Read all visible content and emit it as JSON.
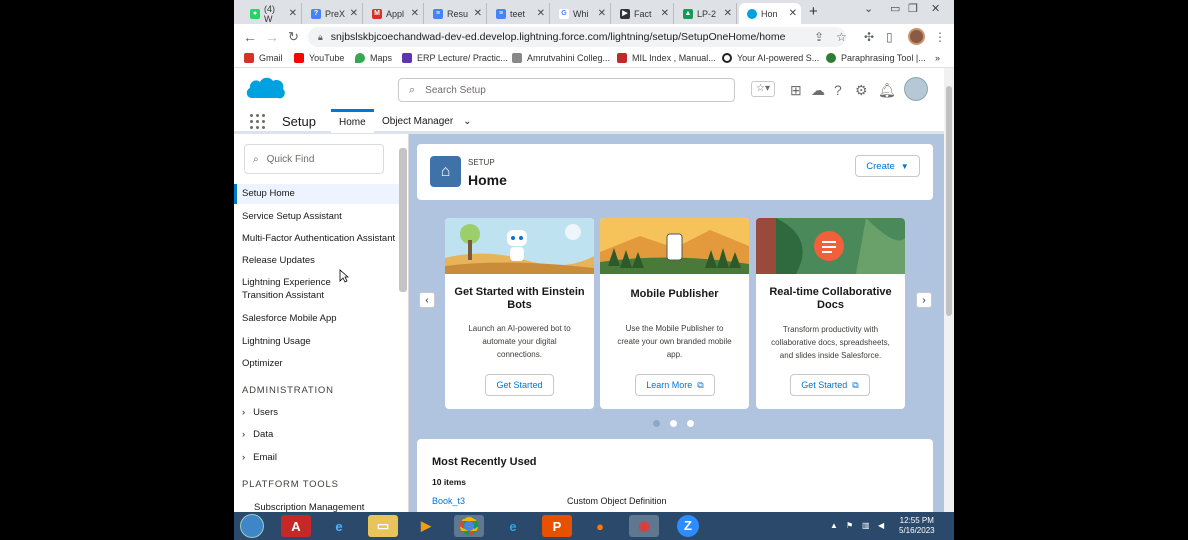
{
  "browser": {
    "tabs": [
      {
        "label": "(4) W",
        "color": "#25d366",
        "icon": "whatsapp-icon"
      },
      {
        "label": "PreX",
        "color": "#4285f4",
        "icon": "question-icon"
      },
      {
        "label": "Appl",
        "color": "#d93025",
        "icon": "gmail-icon"
      },
      {
        "label": "Resu",
        "color": "#4285f4",
        "icon": "docs-icon"
      },
      {
        "label": "teet",
        "color": "#4285f4",
        "icon": "docs-icon"
      },
      {
        "label": "Whi",
        "color": "#4285f4",
        "icon": "google-icon"
      },
      {
        "label": "Fact",
        "color": "#333333",
        "icon": "bookmark-icon"
      },
      {
        "label": "LP-2",
        "color": "#0f9d58",
        "icon": "drive-icon"
      },
      {
        "label": "Hon",
        "color": "#00a1e0",
        "icon": "salesforce-icon"
      }
    ],
    "url": "snjbslskbjcoechandwad-dev-ed.develop.lightning.force.com/lightning/setup/SetupOneHome/home",
    "bookmarks": [
      {
        "label": "Gmail",
        "color": "#d93025"
      },
      {
        "label": "YouTube",
        "color": "#ff0000"
      },
      {
        "label": "Maps",
        "color": "#34a853"
      },
      {
        "label": "ERP Lecture/ Practic...",
        "color": "#5e35b1"
      },
      {
        "label": "Amrutvahini Colleg...",
        "color": "#888888"
      },
      {
        "label": "MIL Index , Manual...",
        "color": "#c62828"
      },
      {
        "label": "Your AI-powered S...",
        "color": "#222222"
      },
      {
        "label": "Paraphrasing Tool |...",
        "color": "#2e7d32"
      }
    ]
  },
  "header": {
    "search_placeholder": "Search Setup"
  },
  "nav": {
    "app_name": "Setup",
    "tabs": [
      "Home",
      "Object Manager"
    ]
  },
  "sidebar": {
    "quick_find_placeholder": "Quick Find",
    "items": [
      "Setup Home",
      "Service Setup Assistant",
      "Multi-Factor Authentication Assistant",
      "Release Updates",
      "Lightning Experience Transition Assistant",
      "Salesforce Mobile App",
      "Lightning Usage",
      "Optimizer"
    ],
    "section_admin": "ADMINISTRATION",
    "admin_items": [
      "Users",
      "Data",
      "Email"
    ],
    "section_platform": "PLATFORM TOOLS",
    "platform_items": [
      "Subscription Management"
    ]
  },
  "home": {
    "setup_label": "SETUP",
    "title": "Home",
    "create_label": "Create",
    "cards": [
      {
        "title": "Get Started with Einstein Bots",
        "desc": "Launch an AI-powered bot to automate your digital connections.",
        "button": "Get Started",
        "external": false
      },
      {
        "title": "Mobile Publisher",
        "desc": "Use the Mobile Publisher to create your own branded mobile app.",
        "button": "Learn More",
        "external": true
      },
      {
        "title": "Real-time Collaborative Docs",
        "desc": "Transform productivity with collaborative docs, spreadsheets, and slides inside Salesforce.",
        "button": "Get Started",
        "external": true
      }
    ],
    "mru_title": "Most Recently Used",
    "mru_count": "10 items",
    "mru_row_name": "Book_t3",
    "mru_row_type": "Custom Object Definition"
  },
  "taskbar": {
    "time": "12:55 PM",
    "date": "5/16/2023"
  },
  "colors": {
    "brand_blue": "#0176d3",
    "page_background": "#b0c4df",
    "salesforce_cloud": "#00a1e0"
  }
}
